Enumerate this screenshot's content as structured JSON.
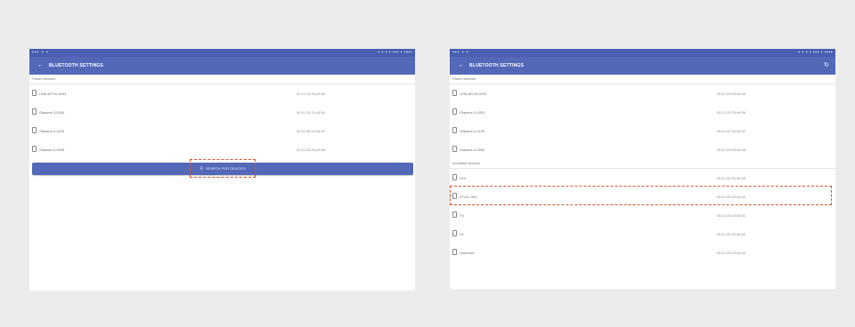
{
  "left_screen": {
    "status": {
      "left": "▪▪▪ ▪ ▪",
      "right": "▪ ▪ ▪ ▪ ▪▪▪ ▪ ▪▪▪▪"
    },
    "toolbar": {
      "back": "←",
      "title": "BLUETOOTH SETTINGS"
    },
    "paired_header": "Paired devices",
    "paired_devices": [
      {
        "name": "LEM-AFG9-2003",
        "address": "00:11:22:33:44:55"
      },
      {
        "name": "Glasses-3-0003",
        "address": "00:11:22:33:44:56"
      },
      {
        "name": "Glasses-2-1145",
        "address": "00:11:22:33:44:57"
      },
      {
        "name": "Glasses-3-0005",
        "address": "00:11:22:33:44:58"
      }
    ],
    "scan_button": {
      "icon": "search-icon",
      "label": "SEARCH FOR DEVICES"
    }
  },
  "right_screen": {
    "status": {
      "left": "▪▪▪ ▪ ▪",
      "right": "▪ ▪ ▪ ▪ ▪▪▪ ▪ ▪▪▪▪"
    },
    "toolbar": {
      "back": "←",
      "title": "BLUETOOTH SETTINGS",
      "refresh": "↻"
    },
    "paired_header": "Paired devices",
    "paired_devices": [
      {
        "name": "LEM-AFG9-2003",
        "address": "00:11:22:33:44:55"
      },
      {
        "name": "Glasses-3-0003",
        "address": "00:11:22:33:44:56"
      },
      {
        "name": "Glasses-2-1145",
        "address": "00:11:22:33:44:57"
      },
      {
        "name": "Glasses-3-0005",
        "address": "00:11:22:33:44:58"
      }
    ],
    "available_header": "Available devices",
    "available_devices": [
      {
        "name": "LE3",
        "address": "00:11:22:33:44:59"
      },
      {
        "name": "ETGC-3H4",
        "address": "00:11:22:33:44:60"
      },
      {
        "name": "TV",
        "address": "00:11:22:33:44:61"
      },
      {
        "name": "LE",
        "address": "00:11:22:33:44:62"
      },
      {
        "name": "Unknown",
        "address": "00:11:22:33:44:63"
      }
    ]
  },
  "colors": {
    "toolbar": "#5468b8",
    "statusbar": "#4a5fb0",
    "highlight": "#d9532c",
    "background": "#ececec"
  }
}
